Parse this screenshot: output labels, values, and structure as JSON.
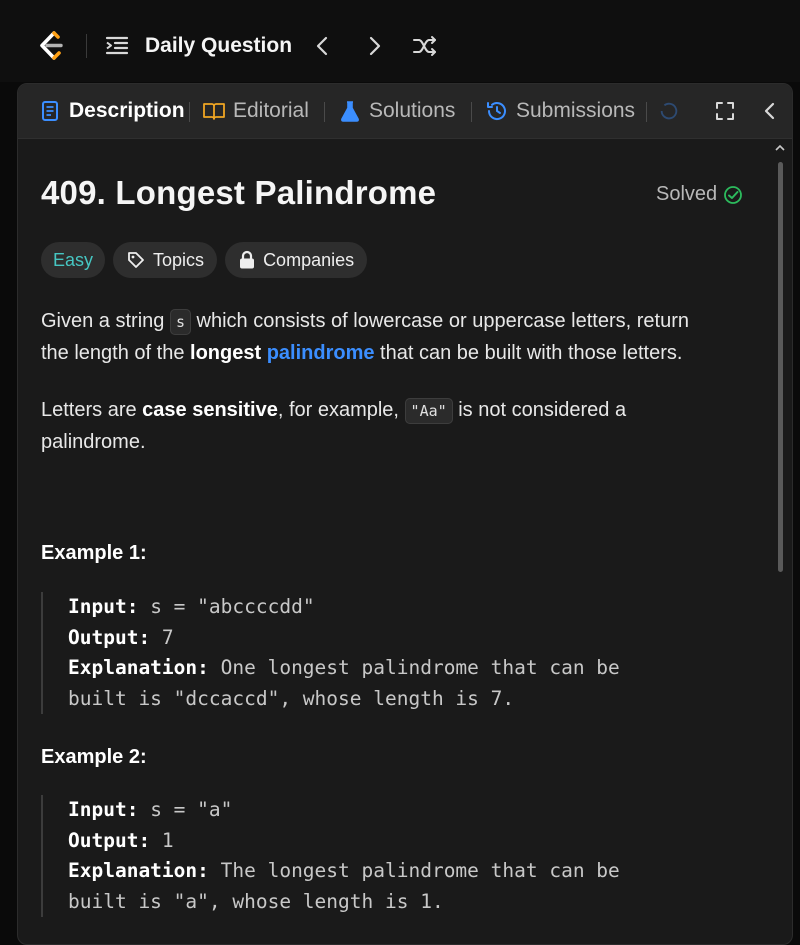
{
  "topbar": {
    "title": "Daily Question"
  },
  "tabs": [
    {
      "label": "Description",
      "icon": "description-icon"
    },
    {
      "label": "Editorial",
      "icon": "book-icon"
    },
    {
      "label": "Solutions",
      "icon": "flask-icon"
    },
    {
      "label": "Submissions",
      "icon": "history-icon"
    }
  ],
  "problem": {
    "title": "409. Longest Palindrome",
    "status": "Solved",
    "difficulty": "Easy",
    "topics_label": "Topics",
    "companies_label": "Companies",
    "desc1_a": "Given a string ",
    "desc1_code": "s",
    "desc1_b": " which consists of lowercase or uppercase letters, return",
    "desc1_c": "the length of the ",
    "desc1_bold": "longest",
    "desc1_link": "palindrome",
    "desc1_d": " that can be built with those letters.",
    "desc2_a": "Letters are ",
    "desc2_bold": "case sensitive",
    "desc2_b": ", for example, ",
    "desc2_code": "\"Aa\"",
    "desc2_c": " is not considered a",
    "desc2_d": "palindrome."
  },
  "examples": [
    {
      "heading": "Example 1:",
      "input_label": "Input:",
      "input": " s = \"abccccdd\"",
      "output_label": "Output:",
      "output": " 7",
      "explanation_label": "Explanation:",
      "explanation_1": " One longest palindrome that can be",
      "explanation_2": "built is \"dccaccd\", whose length is 7."
    },
    {
      "heading": "Example 2:",
      "input_label": "Input:",
      "input": " s = \"a\"",
      "output_label": "Output:",
      "output": " 1",
      "explanation_label": "Explanation:",
      "explanation_1": " The longest palindrome that can be",
      "explanation_2": "built is \"a\", whose length is 1."
    }
  ],
  "colors": {
    "accent_link": "#3b8eff",
    "easy": "#46c6c2",
    "solved_check": "#2cbb5d",
    "logo_orange": "#ffa116"
  }
}
